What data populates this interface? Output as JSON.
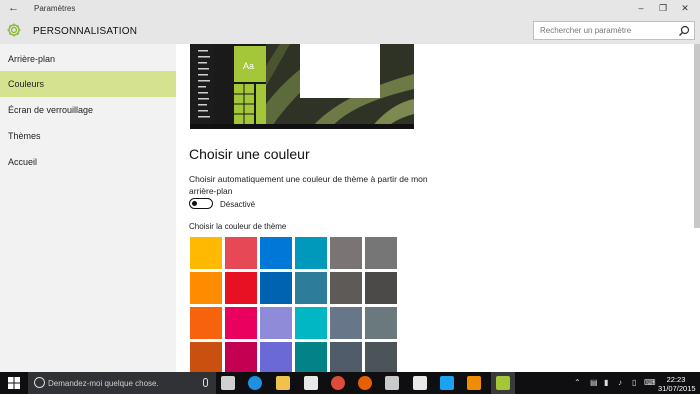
{
  "window": {
    "title": "Paramètres",
    "back_icon": "back-arrow-icon",
    "controls": [
      "minimize-icon",
      "restore-icon",
      "close-icon"
    ]
  },
  "header": {
    "section_title": "PERSONNALISATION",
    "icon": "gear-icon",
    "accent": "#8cba3a"
  },
  "search": {
    "placeholder": "Rechercher un paramètre",
    "icon": "search-icon"
  },
  "sidebar": {
    "items": [
      {
        "label": "Arrière-plan",
        "selected": false
      },
      {
        "label": "Couleurs",
        "selected": true
      },
      {
        "label": "Écran de verrouillage",
        "selected": false
      },
      {
        "label": "Thèmes",
        "selected": false
      },
      {
        "label": "Accueil",
        "selected": false
      }
    ],
    "selected_color": "#d5e28f"
  },
  "preview": {
    "tile_label": "Aa",
    "accent": "#a4c639"
  },
  "main": {
    "heading": "Choisir une couleur",
    "auto_color_text": "Choisir automatiquement une couleur de thème à partir de mon arrière-plan",
    "toggle_state": "Désactivé",
    "theme_color_label": "Choisir la couleur de thème"
  },
  "swatches": [
    [
      "#ffb900",
      "#e74856",
      "#0078d7",
      "#0099bc",
      "#7a7574",
      "#767676"
    ],
    [
      "#ff8c00",
      "#e81123",
      "#0063b1",
      "#2d7d9a",
      "#5d5a58",
      "#4c4a48"
    ],
    [
      "#f7630c",
      "#ea005e",
      "#8e8cd8",
      "#00b7c3",
      "#68768a",
      "#69797e"
    ],
    [
      "#ca5010",
      "#c30052",
      "#6b69d6",
      "#038387",
      "#515c6b",
      "#4a5459"
    ]
  ],
  "taskbar": {
    "search_placeholder": "Demandez-moi quelque chose.",
    "apps": [
      {
        "icon": "task-view-icon",
        "color": "#d0d0d0"
      },
      {
        "icon": "edge-icon",
        "color": "#1e8fe1"
      },
      {
        "icon": "file-explorer-icon",
        "color": "#f0c24b"
      },
      {
        "icon": "store-icon",
        "color": "#e8e8e8"
      },
      {
        "icon": "chrome-icon",
        "color": "#dd4b39"
      },
      {
        "icon": "firefox-icon",
        "color": "#e66000"
      },
      {
        "icon": "paint-icon",
        "color": "#c9c9c9"
      },
      {
        "icon": "calendar-icon",
        "color": "#e8e8e8"
      },
      {
        "icon": "twitter-icon",
        "color": "#1da1f2"
      },
      {
        "icon": "vlc-icon",
        "color": "#f08c00"
      },
      {
        "icon": "settings-app-icon",
        "color": "#a4c639"
      }
    ],
    "time": "22:23",
    "date": "31/07/2015"
  }
}
